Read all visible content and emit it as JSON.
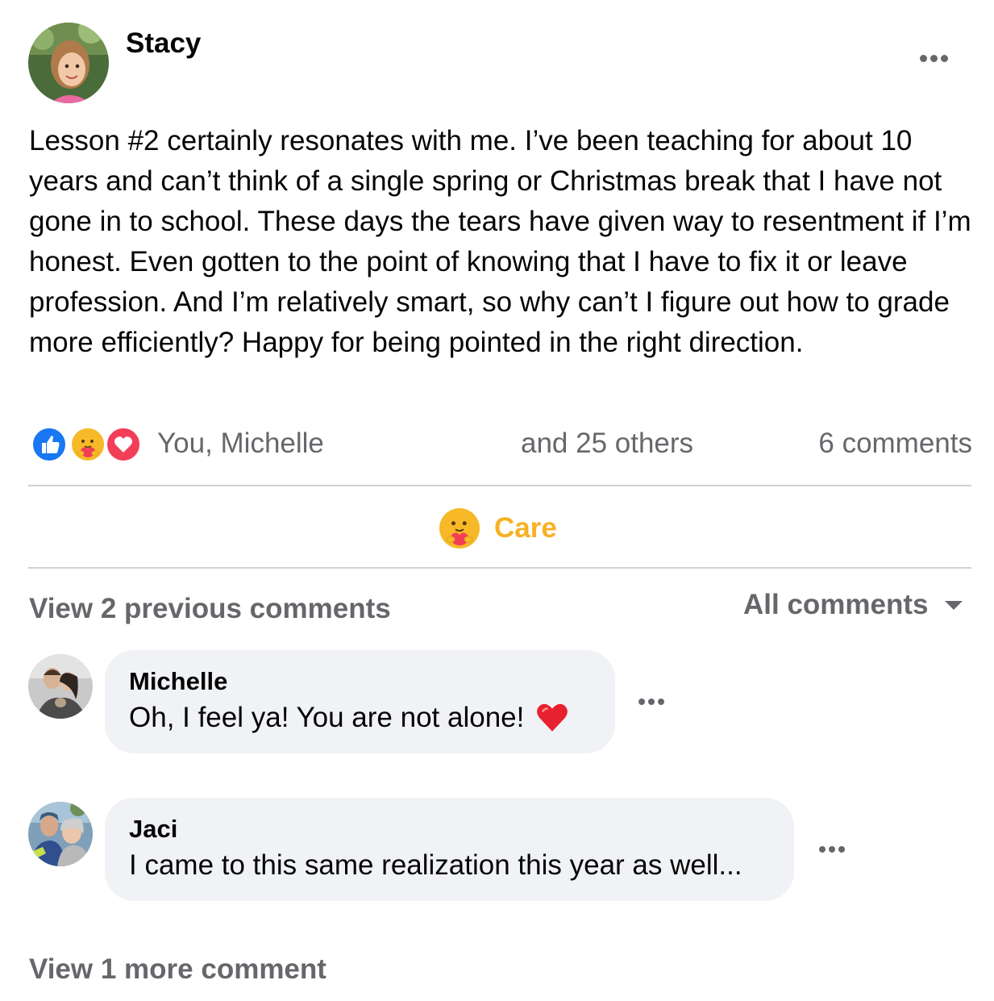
{
  "post": {
    "author": "Stacy",
    "avatar_icon": "profile-photo-girl",
    "body": "Lesson #2 certainly resonates with me. I’ve been teaching for about 10 years and can’t think of a single spring or Christmas break that I have not gone in to school. These days the tears have given way to resentment if I’m honest. Even gotten to the point of knowing that I have to fix it or leave profession. And I’m relatively smart, so why can’t I figure out how to grade more efficiently? Happy for being pointed in the right direction."
  },
  "reactions": {
    "icons": [
      "like-icon",
      "care-icon",
      "love-icon"
    ],
    "names": "You, Michelle",
    "others": "and 25 others",
    "comment_count": "6 comments"
  },
  "actions": {
    "care_label": "Care",
    "care_color": "#f7b125"
  },
  "comments_header": {
    "view_previous": "View 2 previous comments",
    "filter_label": "All comments"
  },
  "comments": [
    {
      "name": "Michelle",
      "text": "Oh, I feel ya! You are not alone!",
      "emoji": "red-heart-icon",
      "avatar_icon": "profile-photo-couple"
    },
    {
      "name": "Jaci",
      "text": "I came to this same realization this year as well...",
      "avatar_icon": "profile-photo-couple-outdoors"
    }
  ],
  "footer": {
    "view_more": "View 1 more comment"
  },
  "colors": {
    "secondary_text": "#65676b",
    "bubble_bg": "#f0f2f5",
    "like_blue": "#1877f2",
    "love_red": "#f33e58",
    "care_yellow": "#f7b928"
  }
}
